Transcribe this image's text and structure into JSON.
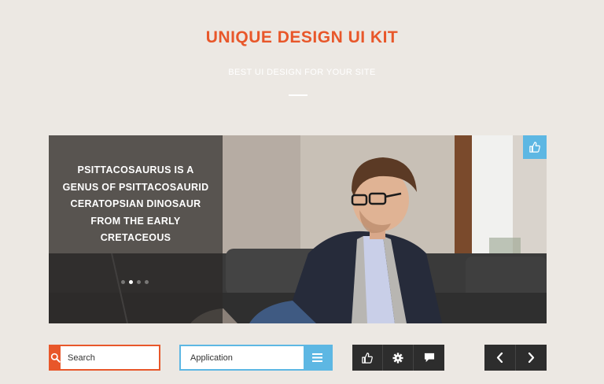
{
  "header": {
    "title": "UNIQUE DESIGN UI KIT",
    "subtitle": "BEST UI DESIGN FOR YOUR SITE"
  },
  "slider": {
    "caption": "PSITTACOSAURUS IS A GENUS OF PSITTACOSAURID CERATOPSIAN DINOSAUR FROM THE EARLY CRETACEOUS",
    "slide_count": 4,
    "active_slide": 2,
    "badge_icon": "thumbs-up-icon"
  },
  "controls": {
    "search": {
      "placeholder": "Search",
      "icon": "search-icon"
    },
    "select": {
      "value": "Application",
      "icon": "menu-icon"
    },
    "actions": [
      "thumbs-up-icon",
      "gear-icon",
      "chat-icon"
    ],
    "navigation": [
      "chevron-left-icon",
      "chevron-right-icon"
    ]
  },
  "colors": {
    "accent_orange": "#e8572a",
    "accent_blue": "#5db7e3",
    "dark": "#2d2d2d",
    "background": "#ece8e3"
  }
}
